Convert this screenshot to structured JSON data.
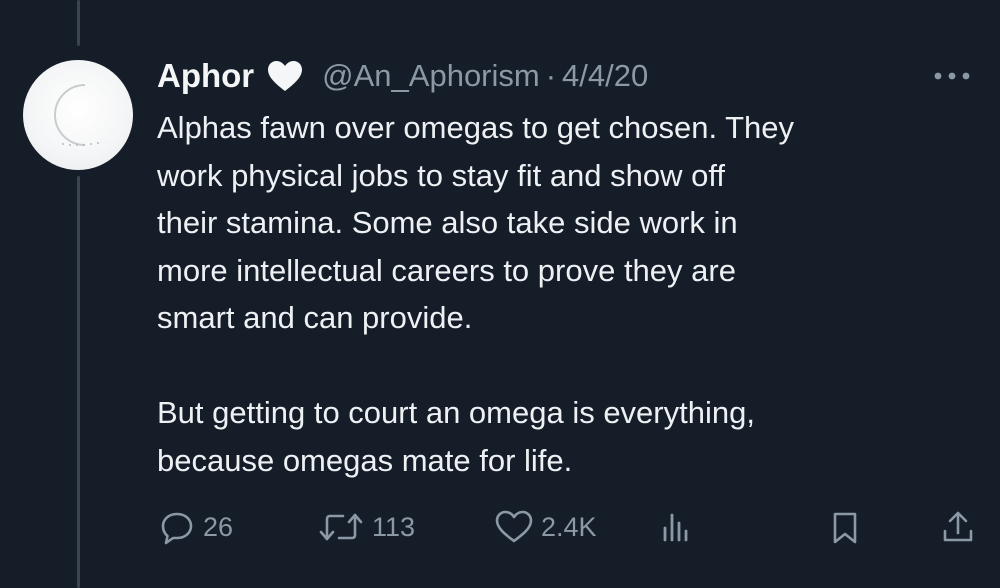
{
  "tweet": {
    "display_name": "Aphor",
    "handle": "@An_Aphorism",
    "separator": "·",
    "date": "4/4/20",
    "badge_icon": "white-heart-icon",
    "paragraphs": [
      [
        "Alphas fawn over omegas to get chosen. They",
        "work physical jobs to stay fit and show off",
        "their stamina. Some also take side work in",
        "more intellectual careers to prove they are",
        "smart and can provide."
      ],
      [
        "But getting to court an omega is everything,",
        "because omegas mate for life."
      ]
    ]
  },
  "actions": {
    "reply_count": "26",
    "retweet_count": "113",
    "like_count": "2.4K",
    "views_icon": "bar-chart-icon",
    "bookmark_icon": "bookmark-icon",
    "share_icon": "share-icon",
    "more_icon": "more-dots-icon"
  },
  "colors": {
    "background": "#151d28",
    "text": "#eef1f4",
    "muted": "#8b98a5",
    "thread_line": "#3a4553"
  }
}
